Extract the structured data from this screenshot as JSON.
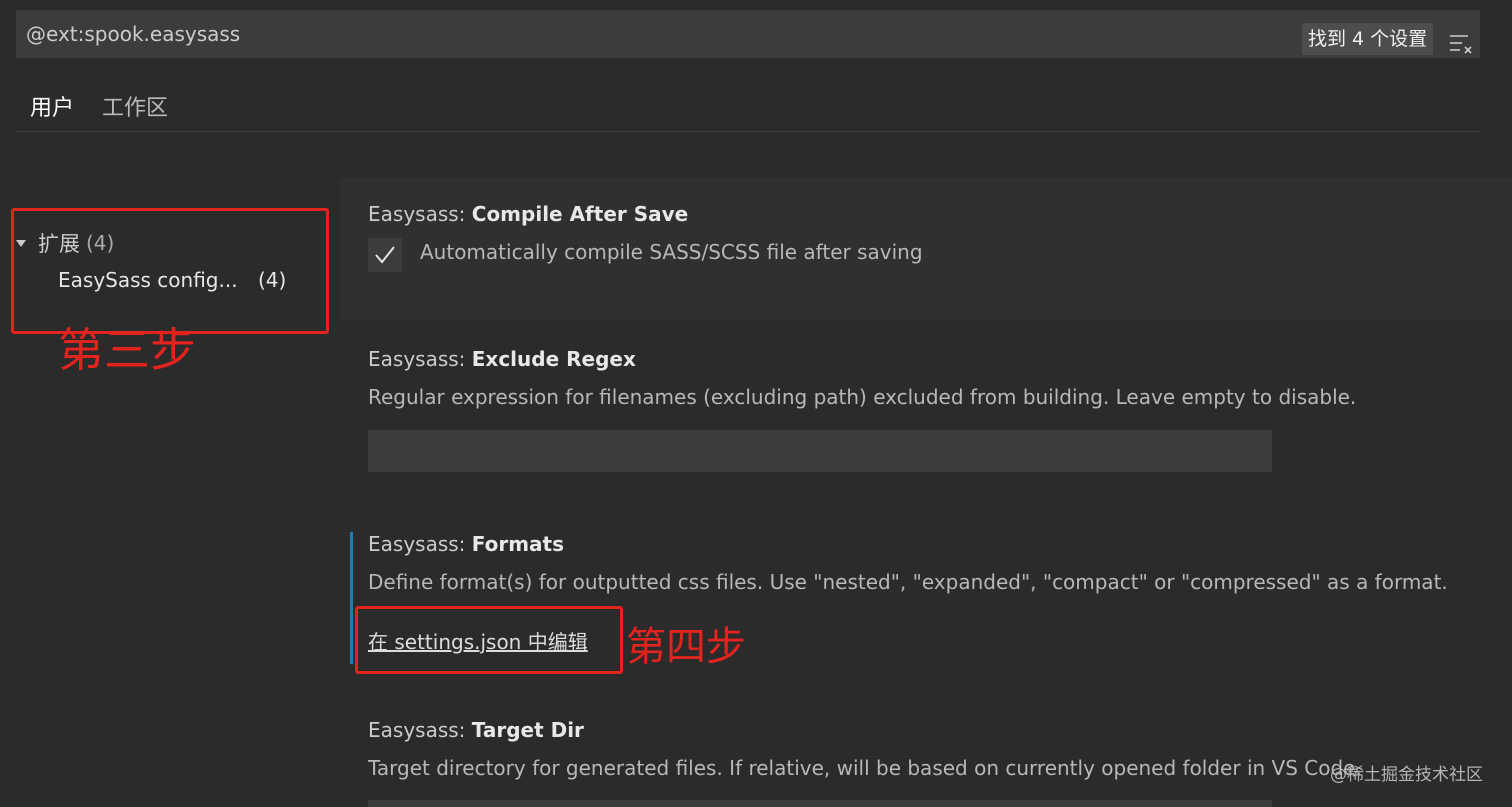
{
  "search": {
    "value": "@ext:spook.easysass",
    "results_badge": "找到 4 个设置"
  },
  "tabs": [
    {
      "label": "用户"
    },
    {
      "label": "工作区"
    }
  ],
  "toc": {
    "group_label": "扩展",
    "group_count": "(4)",
    "items": [
      {
        "label": "EasySass config...",
        "count": "(4)"
      }
    ]
  },
  "settings": [
    {
      "category": "Easysass: ",
      "name": "Compile After Save",
      "description": "Automatically compile SASS/SCSS file after saving",
      "checked": true
    },
    {
      "category": "Easysass: ",
      "name": "Exclude Regex",
      "description": "Regular expression for filenames (excluding path) excluded from building. Leave empty to disable.",
      "value": ""
    },
    {
      "category": "Easysass: ",
      "name": "Formats",
      "description": "Define format(s) for outputted css files. Use \"nested\", \"expanded\", \"compact\" or \"compressed\" as a format.",
      "link": "在 settings.json 中编辑"
    },
    {
      "category": "Easysass: ",
      "name": "Target Dir",
      "description": "Target directory for generated files. If relative, will be based on currently opened folder in VS Code."
    }
  ],
  "annotations": {
    "step3": "第三步",
    "step4": "第四步"
  },
  "watermark": "@稀土掘金技术社区",
  "colors": {
    "annotation": "#e3231e",
    "focus": "#1f7fb5",
    "background": "#2b2b2b"
  }
}
